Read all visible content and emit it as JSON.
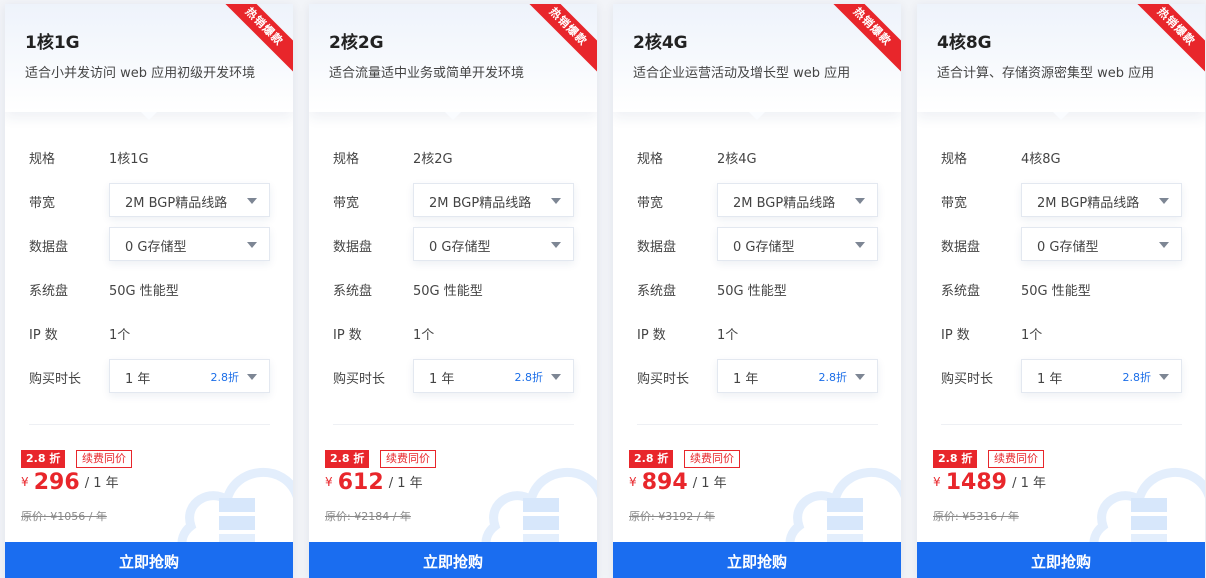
{
  "cards": [
    {
      "ribbon": "热销爆款",
      "title": "1核1G",
      "subtitle": "适合小并发访问 web 应用初级开发环境",
      "spec_label": "规格",
      "spec_value": "1核1G",
      "bandwidth_label": "带宽",
      "bandwidth_value": "2M BGP精品线路",
      "data_disk_label": "数据盘",
      "data_disk_value": "0 G存储型",
      "system_disk_label": "系统盘",
      "system_disk_value": "50G 性能型",
      "ip_label": "IP 数",
      "ip_value": "1个",
      "duration_label": "购买时长",
      "duration_value": "1 年",
      "duration_discount": "2.8折",
      "discount_badge": "2.8 折",
      "renew_badge": "续费同价",
      "currency": "¥",
      "price": "296",
      "per_year": "/ 1 年",
      "original_price": "原价: ¥1056 / 年",
      "buy_label": "立即抢购"
    },
    {
      "ribbon": "热销爆款",
      "title": "2核2G",
      "subtitle": "适合流量适中业务或简单开发环境",
      "spec_label": "规格",
      "spec_value": "2核2G",
      "bandwidth_label": "带宽",
      "bandwidth_value": "2M BGP精品线路",
      "data_disk_label": "数据盘",
      "data_disk_value": "0 G存储型",
      "system_disk_label": "系统盘",
      "system_disk_value": "50G 性能型",
      "ip_label": "IP 数",
      "ip_value": "1个",
      "duration_label": "购买时长",
      "duration_value": "1 年",
      "duration_discount": "2.8折",
      "discount_badge": "2.8 折",
      "renew_badge": "续费同价",
      "currency": "¥",
      "price": "612",
      "per_year": "/ 1 年",
      "original_price": "原价: ¥2184 / 年",
      "buy_label": "立即抢购"
    },
    {
      "ribbon": "热销爆款",
      "title": "2核4G",
      "subtitle": "适合企业运营活动及增长型 web 应用",
      "spec_label": "规格",
      "spec_value": "2核4G",
      "bandwidth_label": "带宽",
      "bandwidth_value": "2M BGP精品线路",
      "data_disk_label": "数据盘",
      "data_disk_value": "0 G存储型",
      "system_disk_label": "系统盘",
      "system_disk_value": "50G 性能型",
      "ip_label": "IP 数",
      "ip_value": "1个",
      "duration_label": "购买时长",
      "duration_value": "1 年",
      "duration_discount": "2.8折",
      "discount_badge": "2.8 折",
      "renew_badge": "续费同价",
      "currency": "¥",
      "price": "894",
      "per_year": "/ 1 年",
      "original_price": "原价: ¥3192 / 年",
      "buy_label": "立即抢购"
    },
    {
      "ribbon": "热销爆款",
      "title": "4核8G",
      "subtitle": "适合计算、存储资源密集型 web 应用",
      "spec_label": "规格",
      "spec_value": "4核8G",
      "bandwidth_label": "带宽",
      "bandwidth_value": "2M BGP精品线路",
      "data_disk_label": "数据盘",
      "data_disk_value": "0 G存储型",
      "system_disk_label": "系统盘",
      "system_disk_value": "50G 性能型",
      "ip_label": "IP 数",
      "ip_value": "1个",
      "duration_label": "购买时长",
      "duration_value": "1 年",
      "duration_discount": "2.8折",
      "discount_badge": "2.8 折",
      "renew_badge": "续费同价",
      "currency": "¥",
      "price": "1489",
      "per_year": "/ 1 年",
      "original_price": "原价: ¥5316 / 年",
      "buy_label": "立即抢购"
    }
  ],
  "colors": {
    "accent_red": "#e8262b",
    "button_blue": "#1a6df0",
    "discount_blue": "#1b6ee8"
  },
  "icons": [
    "dropdown-caret-icon",
    "cloud-server-icon"
  ]
}
